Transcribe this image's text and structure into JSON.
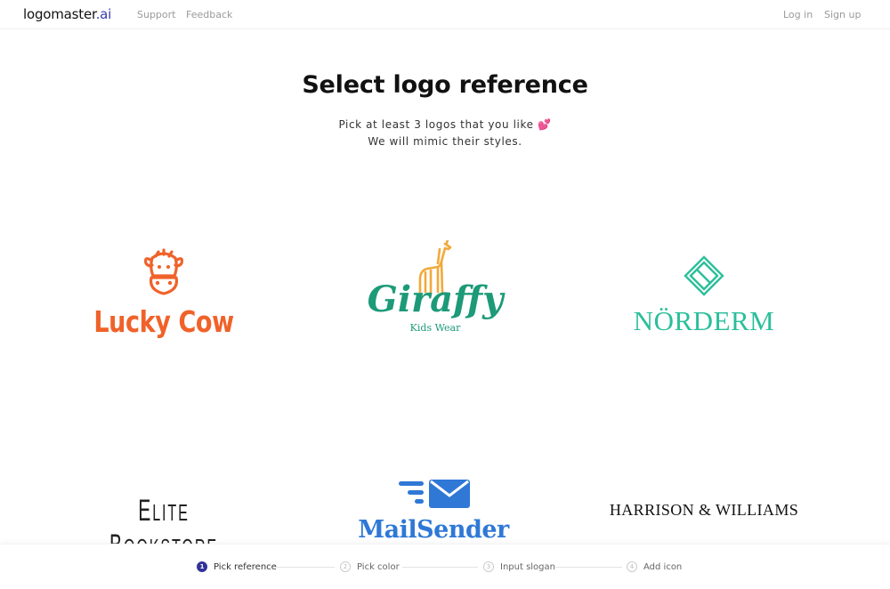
{
  "header": {
    "brand_main": "logomaster",
    "brand_tld": ".ai",
    "nav": [
      "Support",
      "Feedback"
    ],
    "auth": [
      "Log in",
      "Sign up"
    ]
  },
  "main": {
    "title": "Select logo reference",
    "subtitle_line1": "Pick at least 3 logos that you like 💕",
    "subtitle_line2": "We will mimic their styles."
  },
  "logos": [
    {
      "name": "Lucky Cow",
      "text": "Lucky Cow",
      "icon": "cow-head-icon",
      "color": "#f0622a"
    },
    {
      "name": "Giraffy",
      "text": "Giraffy",
      "subtitle": "Kids Wear",
      "icon": "giraffe-icon",
      "color": "#1d9a78",
      "icon_color": "#f2a93b"
    },
    {
      "name": "Norderm",
      "text": "NÖRDERM",
      "icon": "diamond-icon",
      "color": "#2bbf9a"
    },
    {
      "name": "Elite Bookstore",
      "text_parts": [
        "E",
        "LITE ",
        "B",
        "OOKSTORE"
      ],
      "color": "#222222"
    },
    {
      "name": "MailSender",
      "text": "MailSender",
      "icon": "envelope-speed-icon",
      "color": "#2f78d6"
    },
    {
      "name": "Harrison & Williams",
      "text": "HARRISON & WILLIAMS",
      "color": "#111111"
    }
  ],
  "stepper": {
    "steps": [
      {
        "num": "1",
        "label": "Pick reference",
        "active": true
      },
      {
        "num": "2",
        "label": "Pick color",
        "active": false
      },
      {
        "num": "3",
        "label": "Input slogan",
        "active": false
      },
      {
        "num": "4",
        "label": "Add icon",
        "active": false
      }
    ],
    "accent": "#32329a"
  }
}
